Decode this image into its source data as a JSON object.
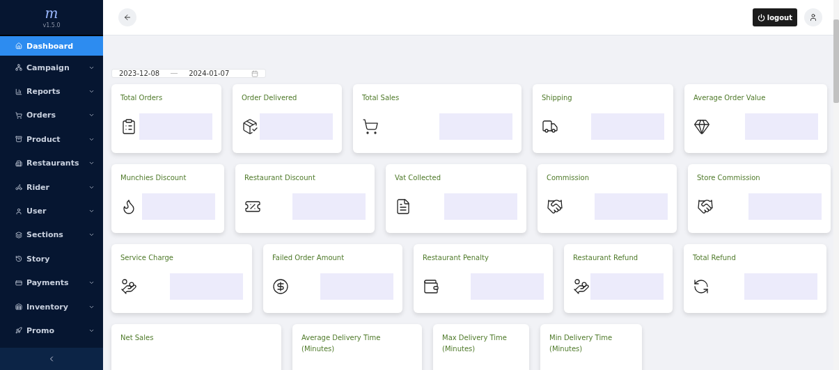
{
  "sidebar": {
    "logo": "m",
    "version": "v1.5.0",
    "items": [
      {
        "label": "Dashboard",
        "selected": true,
        "has_submenu": false
      },
      {
        "label": "Campaign",
        "selected": false,
        "has_submenu": true
      },
      {
        "label": "Reports",
        "selected": false,
        "has_submenu": true
      },
      {
        "label": "Orders",
        "selected": false,
        "has_submenu": true
      },
      {
        "label": "Product",
        "selected": false,
        "has_submenu": true
      },
      {
        "label": "Restaurants",
        "selected": false,
        "has_submenu": true
      },
      {
        "label": "Rider",
        "selected": false,
        "has_submenu": true
      },
      {
        "label": "User",
        "selected": false,
        "has_submenu": true
      },
      {
        "label": "Sections",
        "selected": false,
        "has_submenu": true
      },
      {
        "label": "Story",
        "selected": false,
        "has_submenu": false
      },
      {
        "label": "Payments",
        "selected": false,
        "has_submenu": true
      },
      {
        "label": "Inventory",
        "selected": false,
        "has_submenu": true
      },
      {
        "label": "Promo",
        "selected": false,
        "has_submenu": true
      }
    ]
  },
  "header": {
    "logout": "logout"
  },
  "date_range": {
    "start": "2023-12-08",
    "end": "2024-01-07"
  },
  "card_rows": [
    [
      {
        "title": "Total Orders"
      },
      {
        "title": "Order Delivered"
      },
      {
        "title": "Total Sales"
      },
      {
        "title": "Shipping"
      },
      {
        "title": "Average Order Value"
      }
    ],
    [
      {
        "title": "Munchies Discount"
      },
      {
        "title": "Restaurant Discount"
      },
      {
        "title": "Vat Collected"
      },
      {
        "title": "Commission"
      },
      {
        "title": "Store Commission"
      }
    ],
    [
      {
        "title": "Service Charge"
      },
      {
        "title": "Failed Order Amount"
      },
      {
        "title": "Restaurant Penalty"
      },
      {
        "title": "Restaurant Refund"
      },
      {
        "title": "Total Refund"
      }
    ],
    [
      {
        "title": "Net Sales"
      },
      {
        "title": "Average Delivery Time (Minutes)"
      },
      {
        "title": "Max Delivery Time (Minutes)"
      },
      {
        "title": "Min Delivery Time (Minutes)"
      }
    ]
  ]
}
